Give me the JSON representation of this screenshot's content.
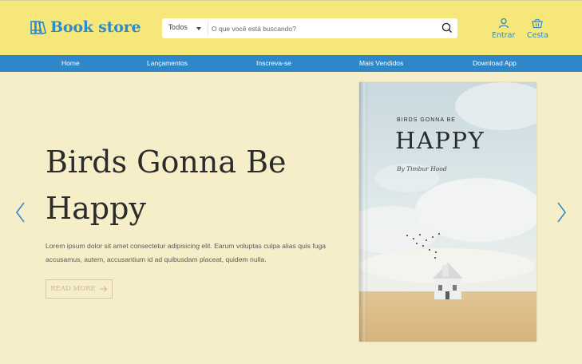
{
  "brand": {
    "name": "Book store",
    "icon": "books-icon",
    "color": "#2f8bc9"
  },
  "search": {
    "category": "Todos",
    "placeholder": "O que você está buscando?",
    "icon": "search-icon"
  },
  "account": {
    "login_label": "Entrar",
    "cart_label": "Cesta"
  },
  "nav": {
    "items": [
      "Home",
      "Lançamentos",
      "Inscreva-se",
      "Mais Vendidos",
      "Download App"
    ]
  },
  "hero": {
    "title": "Birds Gonna Be Happy",
    "description": "Lorem ipsum dolor sit amet consectetur adipisicing elit. Earum voluptas culpa alias quis fuga accusamus, autem, accusantium id ad quibusdam placeat, quidem nulla.",
    "button_label": "READ MORE"
  },
  "book_cover": {
    "subtitle": "BIRDS GONNA BE",
    "title": "HAPPY",
    "author": "By Timbur Hood"
  },
  "colors": {
    "header_bg": "#f6e77a",
    "nav_bg": "#2e87c8",
    "page_bg": "#f6eec8",
    "accent": "#2f8bc9"
  }
}
